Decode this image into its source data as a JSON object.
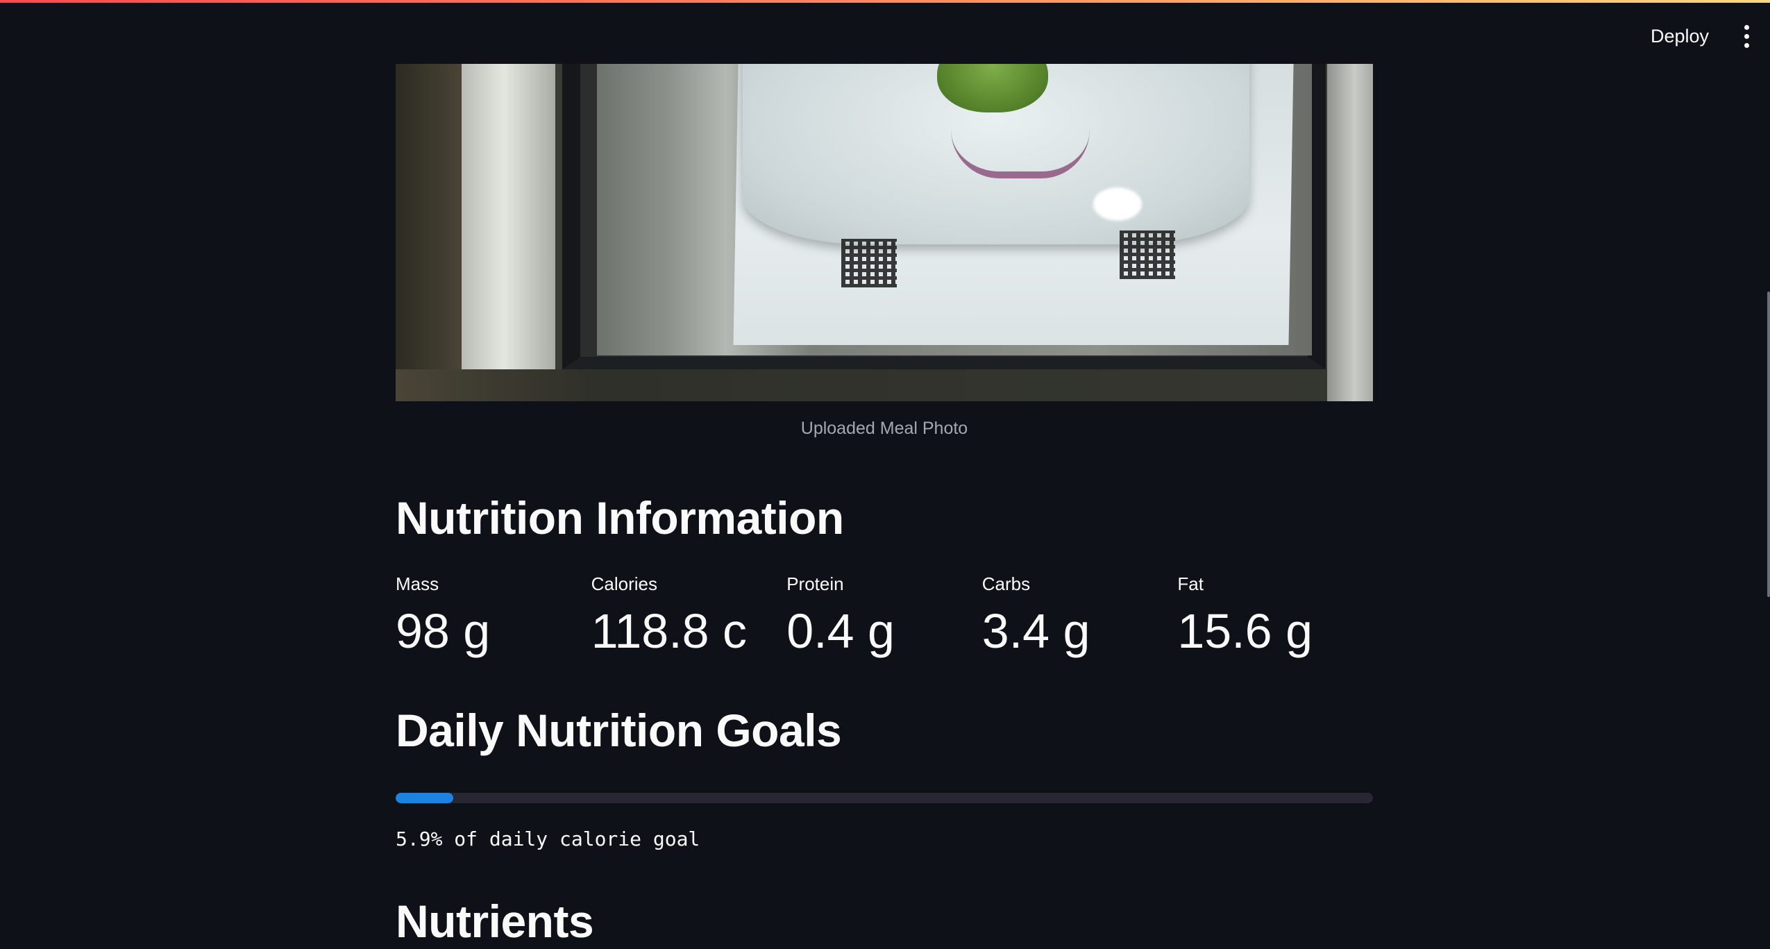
{
  "header": {
    "deploy_label": "Deploy",
    "menu_icon": "kebab-menu-icon"
  },
  "photo": {
    "caption": "Uploaded Meal Photo"
  },
  "nutrition": {
    "title": "Nutrition Information",
    "metrics": [
      {
        "label": "Mass",
        "value": "98 g"
      },
      {
        "label": "Calories",
        "value": "118.8 c"
      },
      {
        "label": "Protein",
        "value": "0.4 g"
      },
      {
        "label": "Carbs",
        "value": "3.4 g"
      },
      {
        "label": "Fat",
        "value": "15.6 g"
      }
    ]
  },
  "goals": {
    "title": "Daily Nutrition Goals",
    "progress_fraction": 0.059,
    "progress_text": "5.9% of daily calorie goal",
    "progress_color": "#1c83e1"
  },
  "next_section": {
    "title": "Nutrients"
  },
  "colors": {
    "background": "#0e1117",
    "text": "#fafafa",
    "caption": "#a3a8b4",
    "track": "#262730"
  }
}
